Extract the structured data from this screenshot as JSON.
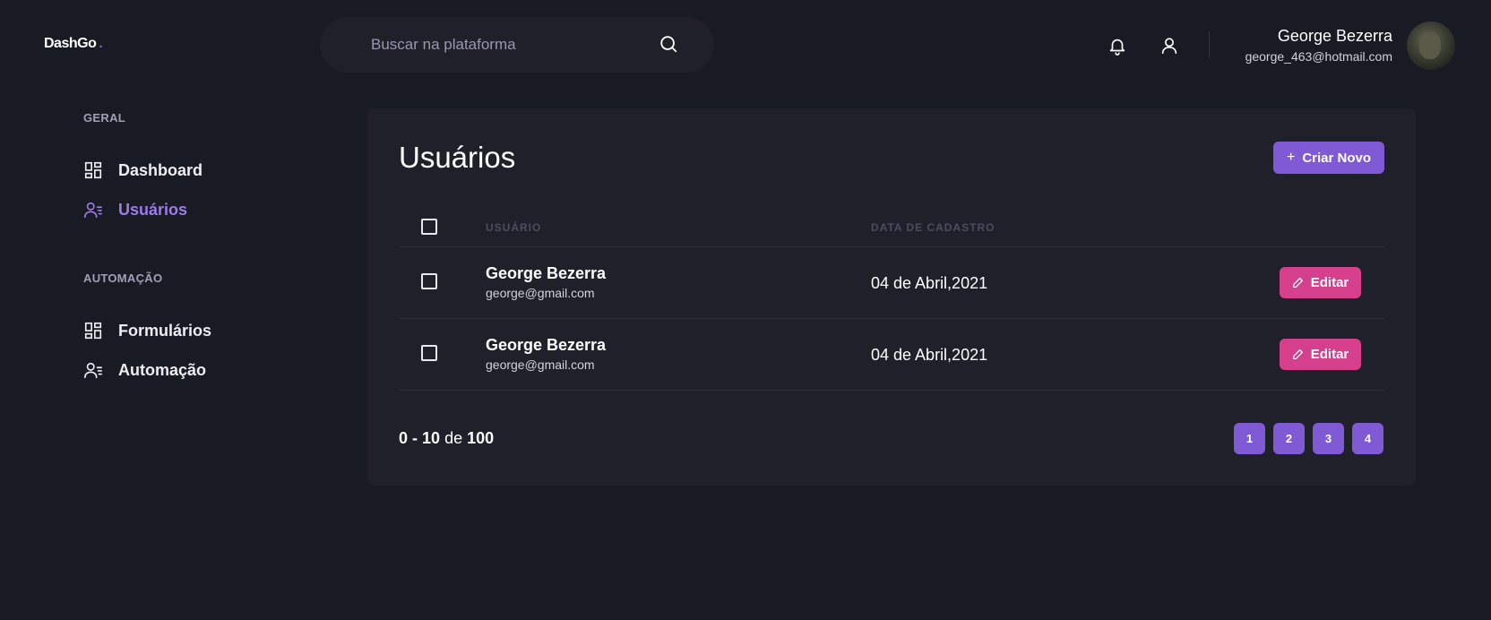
{
  "header": {
    "logo": "DashGo",
    "logo_dot": ".",
    "search_placeholder": "Buscar na plataforma",
    "profile_name": "George Bezerra",
    "profile_email": "george_463@hotmail.com"
  },
  "sidebar": {
    "sections": [
      {
        "title": "GERAL",
        "items": [
          {
            "label": "Dashboard",
            "icon": "dashboard-icon"
          },
          {
            "label": "Usuários",
            "icon": "users-icon",
            "active": true
          }
        ]
      },
      {
        "title": "AUTOMAÇÃO",
        "items": [
          {
            "label": "Formulários",
            "icon": "forms-icon"
          },
          {
            "label": "Automação",
            "icon": "automation-icon"
          }
        ]
      }
    ]
  },
  "main": {
    "title": "Usuários",
    "create_button": "Criar Novo",
    "table": {
      "columns": [
        "USUÁRIO",
        "DATA DE CADASTRO"
      ],
      "rows": [
        {
          "name": "George Bezerra",
          "email": "george@gmail.com",
          "date": "04 de Abril,2021",
          "action": "Editar"
        },
        {
          "name": "George Bezerra",
          "email": "george@gmail.com",
          "date": "04 de Abril,2021",
          "action": "Editar"
        }
      ]
    },
    "pagination": {
      "from": "0",
      "to": "10",
      "separator": "-",
      "of_label": "de",
      "total": "100",
      "pages": [
        "1",
        "2",
        "3",
        "4"
      ]
    }
  },
  "colors": {
    "background": "#181b23",
    "surface": "#1f2029",
    "accent_purple": "#805ad5",
    "accent_pink": "#d53f8c",
    "active_link": "#9f7aea"
  }
}
